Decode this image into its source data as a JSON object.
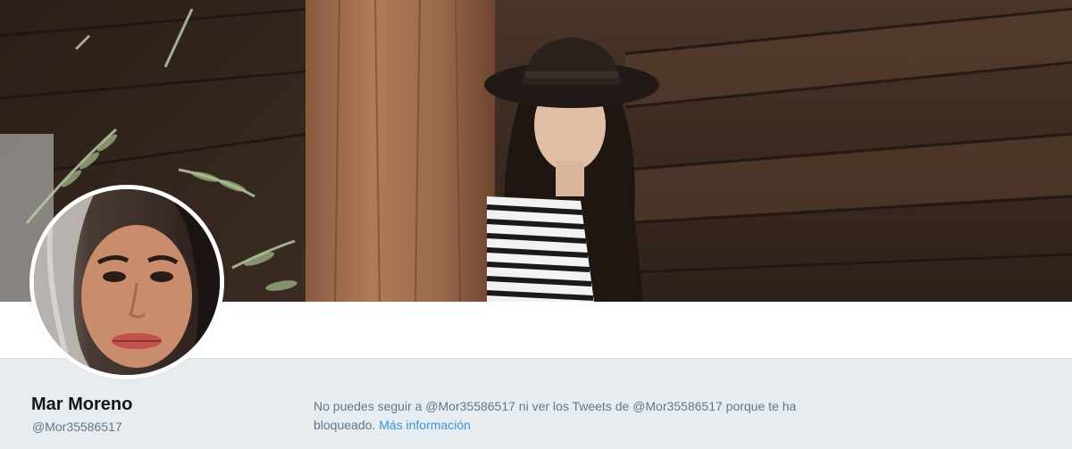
{
  "profile": {
    "name": "Mar Moreno",
    "handle": "@Mor35586517"
  },
  "blocked_notice": {
    "text": "No puedes seguir a @Mor35586517 ni ver los Tweets de @Mor35586517 porque te ha bloqueado.",
    "link_label": "Más información"
  },
  "colors": {
    "page_background": "#e6ecf0",
    "link": "#3b94d9",
    "name_text": "#14171a",
    "secondary_text": "#657786"
  },
  "icons": {
    "header_image": "header-photo",
    "avatar_image": "avatar-photo"
  }
}
